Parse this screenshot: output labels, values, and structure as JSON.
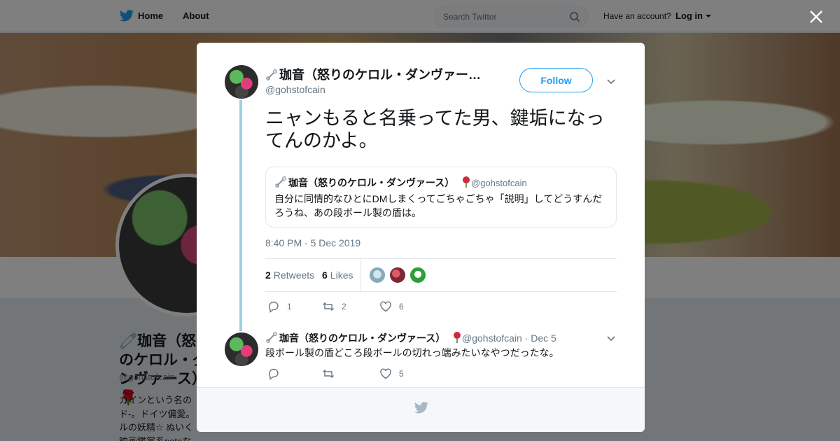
{
  "topbar": {
    "home_label": "Home",
    "about_label": "About",
    "search_placeholder": "Search Twitter",
    "have_account": "Have an account?",
    "login_label": "Log in"
  },
  "profile": {
    "name": "🧷珈音（怒りのケロル・ダンヴァース）🌹",
    "handle": "@gohstofcain",
    "bio": "カインという名のド-。ドイツ偏愛。ルの妖精☆ ぬいく映画鑑賞系noteなど"
  },
  "tweet": {
    "author_name": "珈音（怒りのケロル・ダンヴァー…",
    "author_handle": "@gohstofcain",
    "follow_label": "Follow",
    "text": "ニャンもると名乗ってた男、鍵垢になってんのかよ。",
    "quoted": {
      "author_name": "珈音（怒りのケロル・ダンヴァース）",
      "author_handle": "@gohstofcain",
      "text": "自分に同情的なひとにDMしまくってごちゃごちゃ「説明」してどうすんだろうね、あの段ボール製の盾は。"
    },
    "timestamp": "8:40 PM - 5 Dec 2019",
    "retweets_count": "2",
    "retweets_label": "Retweets",
    "likes_count": "6",
    "likes_label": "Likes",
    "actions": {
      "replies": "1",
      "retweets": "2",
      "likes": "6"
    }
  },
  "reply": {
    "author_name": "珈音（怒りのケロル・ダンヴァース）",
    "author_handle": "@gohstofcain",
    "date": "· Dec 5",
    "text": "段ボール製の盾どころ段ボールの切れっ端みたいなやつだったな。",
    "actions": {
      "replies": "",
      "retweets": "",
      "likes": "5"
    }
  },
  "colors": {
    "accent": "#1da1f2",
    "thread_line": "#9fcfe3",
    "like_heart": "#e0245e"
  },
  "icons": [
    "twitter-bird-icon",
    "search-icon",
    "close-icon",
    "chevron-down-icon",
    "reply-icon",
    "retweet-icon",
    "heart-icon",
    "safety-pin-emoji",
    "rose-emoji"
  ]
}
